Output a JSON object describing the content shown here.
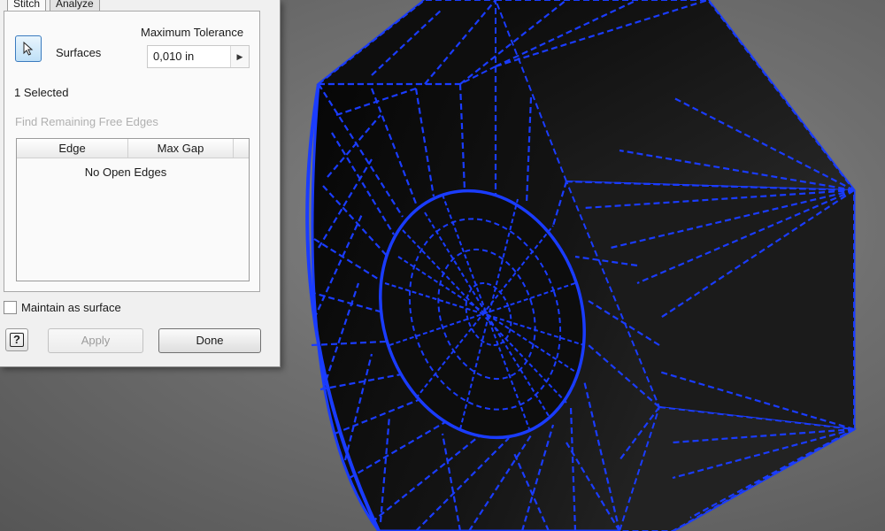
{
  "tabs": [
    {
      "label": "Stitch",
      "active": true
    },
    {
      "label": "Analyze",
      "active": false
    }
  ],
  "surfaces": {
    "label": "Surfaces",
    "selected_text": "1 Selected"
  },
  "tolerance": {
    "label": "Maximum Tolerance",
    "value": "0,010 in"
  },
  "find_edges_label": "Find Remaining Free Edges",
  "edge_table": {
    "columns": [
      "Edge",
      "Max Gap"
    ],
    "empty_text": "No Open Edges"
  },
  "maintain_label": "Maintain as surface",
  "maintain_checked": false,
  "buttons": {
    "apply": "Apply",
    "done": "Done",
    "help": "?"
  },
  "colors": {
    "wireframe": "#1a3cff",
    "model_fill": "#0a0a0a",
    "background": "#6f6f6f",
    "disabled_text": "#b0b0b0"
  }
}
